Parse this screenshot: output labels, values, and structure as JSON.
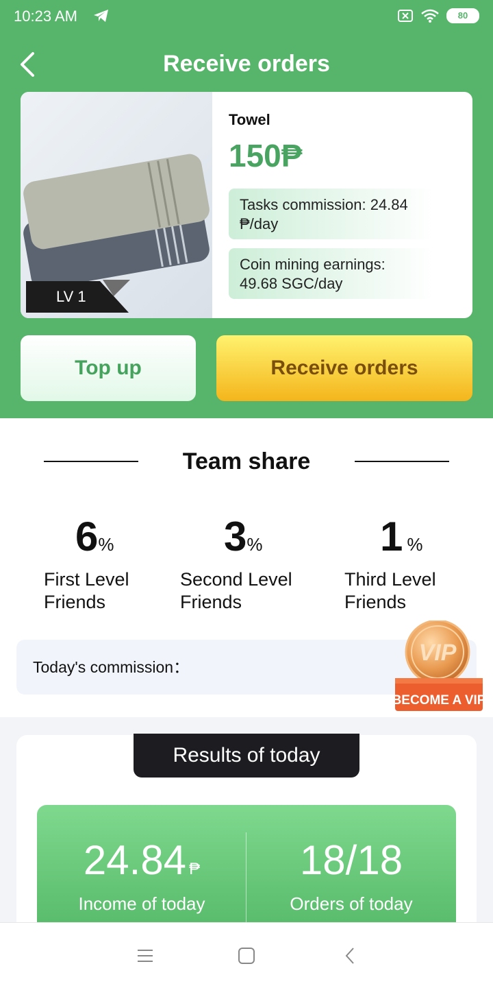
{
  "status_bar": {
    "time": "10:23 AM",
    "battery": "80"
  },
  "header": {
    "title": "Receive orders"
  },
  "product": {
    "name": "Towel",
    "price": "150₱",
    "level_badge": "LV 1",
    "tasks_commission": "Tasks commission:  24.84 ₱/day",
    "coin_mining": "Coin mining earnings:  49.68 SGC/day"
  },
  "actions": {
    "top_up": "Top up",
    "receive_orders": "Receive orders"
  },
  "team_share": {
    "title": "Team share",
    "levels": [
      {
        "value": "6",
        "unit": "%",
        "label": "First Level Friends"
      },
      {
        "value": "3",
        "unit": "%",
        "label": "Second Level Friends"
      },
      {
        "value": "1",
        "unit": "%",
        "label": "Third Level Friends"
      }
    ],
    "commission_label": "Today's commission："
  },
  "vip_badge": {
    "label": "BECOME A VIP",
    "coin_text": "VIP"
  },
  "results": {
    "title": "Results of today",
    "income_value": "24.84",
    "income_unit": "₱",
    "income_label": "Income of today",
    "orders_value": "18/18",
    "orders_label": "Orders of today"
  },
  "colors": {
    "primary_green": "#56b56a",
    "button_yellow": "#f4b51c",
    "dark": "#1d1c21"
  }
}
